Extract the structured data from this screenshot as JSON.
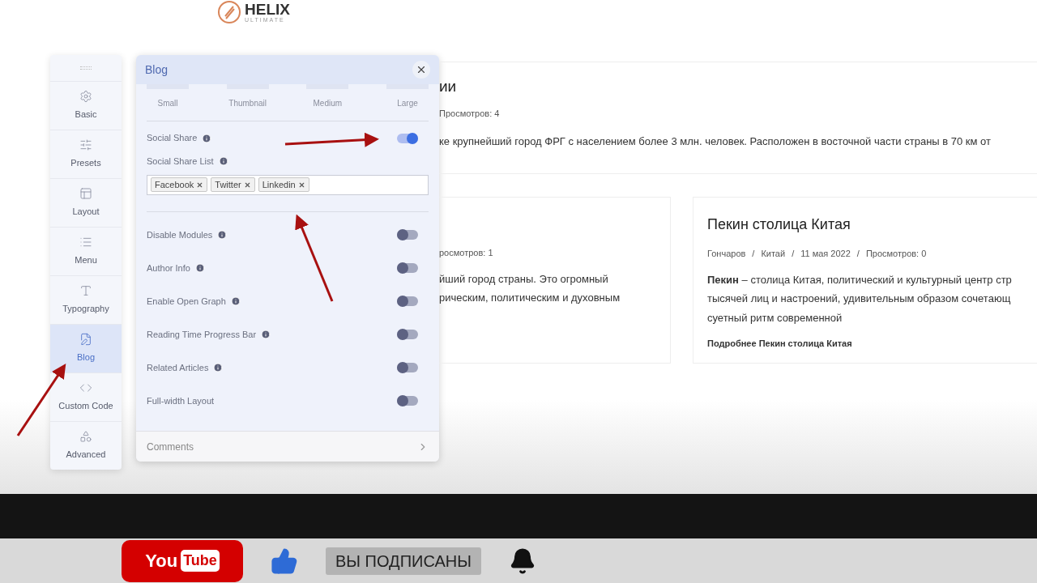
{
  "header": {
    "logo_text": "HELIX",
    "logo_subtext": "ULTIMATE"
  },
  "sidebar": {
    "items": [
      {
        "label": "Basic",
        "selected": false
      },
      {
        "label": "Presets",
        "selected": false
      },
      {
        "label": "Layout",
        "selected": false
      },
      {
        "label": "Menu",
        "selected": false
      },
      {
        "label": "Typography",
        "selected": false
      },
      {
        "label": "Blog",
        "selected": true
      },
      {
        "label": "Custom Code",
        "selected": false
      },
      {
        "label": "Advanced",
        "selected": false
      }
    ]
  },
  "panel": {
    "title": "Blog",
    "image_sizes": [
      "Small",
      "Thumbnail",
      "Medium",
      "Large"
    ],
    "settings": [
      {
        "kind": "toggle",
        "label": "Social Share",
        "info": true,
        "on": true
      },
      {
        "kind": "tags",
        "label": "Social Share List",
        "info": true,
        "tags": [
          "Facebook",
          "Twitter",
          "Linkedin"
        ]
      },
      {
        "kind": "toggle",
        "label": "Disable Modules",
        "info": true,
        "on": false
      },
      {
        "kind": "toggle",
        "label": "Author Info",
        "info": true,
        "on": false
      },
      {
        "kind": "toggle",
        "label": "Enable Open Graph",
        "info": true,
        "on": false
      },
      {
        "kind": "toggle",
        "label": "Reading Time Progress Bar",
        "info": true,
        "on": false
      },
      {
        "kind": "toggle",
        "label": "Related Articles",
        "info": true,
        "on": false
      },
      {
        "kind": "toggle",
        "label": "Full-width Layout",
        "info": false,
        "on": false
      }
    ],
    "footer": "Comments"
  },
  "article": {
    "title": "ии",
    "meta": "Просмотров: 4",
    "excerpt": "ке крупнейший город ФРГ с населением более 3 млн. человек. Расположен в восточной части страны в 70 км от"
  },
  "cards": [
    {
      "meta": [
        "росмотров: 1"
      ],
      "lines": [
        "йший город страны. Это огромный",
        "рическим, политическим и духовным"
      ]
    },
    {
      "title": "Пекин столица Китая",
      "meta": [
        "Гончаров",
        "/",
        "Китай",
        "/",
        "11 мая 2022",
        "/",
        "Просмотров: 0"
      ],
      "lines": [
        "**Пекин** – столица Китая, политический и культурный центр стр",
        "тысячей лиц и настроений, удивительным образом сочетающ",
        "суетный ритм современной"
      ],
      "read_more": "Подробнее Пекин столица Китая"
    }
  ],
  "video_overlay": {
    "logo_top": "You",
    "logo_bottom": "Tube",
    "subscribe": "ВЫ ПОДПИСАНЫ"
  }
}
